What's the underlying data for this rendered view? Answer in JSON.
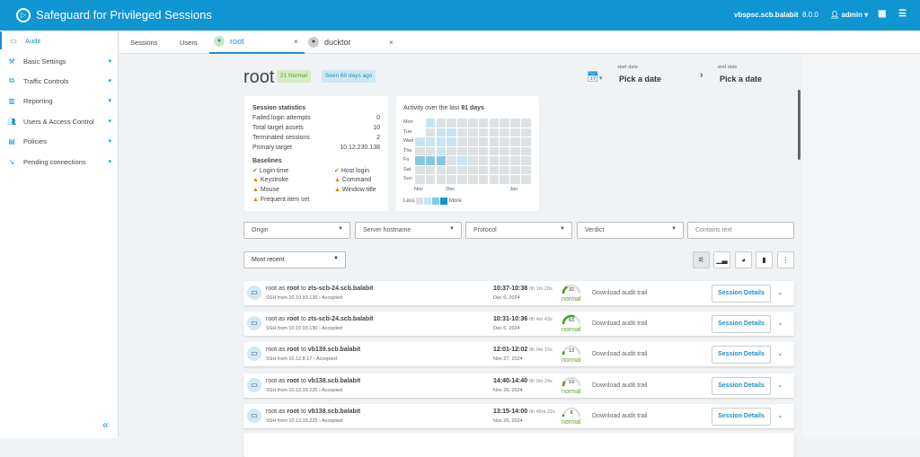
{
  "header": {
    "title": "Safeguard for Privileged Sessions",
    "host": "vbspsc.scb.balabit",
    "version": "8.0.0",
    "user": "admin"
  },
  "sidebar": {
    "items": [
      {
        "label": "Audit",
        "icon": "monitor-icon"
      },
      {
        "label": "Basic Settings",
        "icon": "wrench-icon"
      },
      {
        "label": "Traffic Controls",
        "icon": "network-icon"
      },
      {
        "label": "Reporting",
        "icon": "chart-icon"
      },
      {
        "label": "Users & Access Control",
        "icon": "users-icon"
      },
      {
        "label": "Policies",
        "icon": "policy-icon"
      },
      {
        "label": "Pending connections",
        "icon": "plug-icon"
      }
    ]
  },
  "tabs": [
    {
      "label": "Sessions"
    },
    {
      "label": "Users"
    },
    {
      "label": "root"
    },
    {
      "label": "ducktor"
    }
  ],
  "user": {
    "name": "root",
    "normal_badge": "21 Normal",
    "seen_badge": "Seen 60 days ago"
  },
  "dates": {
    "start_label": "start date",
    "start_value": "Pick a date",
    "end_label": "end date",
    "end_value": "Pick a date"
  },
  "stats": {
    "title": "Session statistics",
    "rows": [
      {
        "k": "Failed login attempts",
        "v": "0"
      },
      {
        "k": "Total target assets",
        "v": "10"
      },
      {
        "k": "Terminated sessions",
        "v": "2"
      },
      {
        "k": "Primary target",
        "v": "10.12.230.138"
      }
    ],
    "baselines_title": "Baselines",
    "baselines": [
      {
        "label": "Login time",
        "status": "ok"
      },
      {
        "label": "Host login",
        "status": "ok"
      },
      {
        "label": "Keystroke",
        "status": "warn"
      },
      {
        "label": "Command",
        "status": "warn"
      },
      {
        "label": "Mouse",
        "status": "warn"
      },
      {
        "label": "Window title",
        "status": "warn"
      },
      {
        "label": "Frequent item set",
        "status": "warn"
      }
    ]
  },
  "activity": {
    "title_prefix": "Activity over the last",
    "title_bold": "91 days",
    "days": [
      "Mon",
      "Tue",
      "Wed",
      "Thu",
      "Fri",
      "Sat",
      "Sun"
    ],
    "months": [
      "Nov",
      "Dec",
      "Jan"
    ],
    "less": "Less",
    "more": "More",
    "levels": [
      [
        null,
        1,
        0,
        0,
        0,
        0,
        0,
        0,
        0,
        0,
        0
      ],
      [
        null,
        0,
        1,
        1,
        0,
        0,
        0,
        0,
        0,
        0,
        0
      ],
      [
        1,
        1,
        1,
        1,
        0,
        0,
        0,
        0,
        0,
        0,
        0
      ],
      [
        0,
        0,
        1,
        0,
        0,
        0,
        0,
        0,
        0,
        0,
        0
      ],
      [
        2,
        2,
        2,
        0,
        1,
        0,
        0,
        0,
        0,
        0,
        0
      ],
      [
        0,
        0,
        0,
        0,
        0,
        0,
        0,
        0,
        0,
        0,
        0
      ],
      [
        0,
        0,
        0,
        0,
        0,
        0,
        0,
        0,
        0,
        0,
        0
      ]
    ],
    "colors": [
      "#dde1e4",
      "#c6e5f1",
      "#85c7e2",
      "#0f95d2"
    ]
  },
  "filters": {
    "origin": "Origin",
    "server": "Server hostname",
    "protocol": "Protocol",
    "verdict": "Verdict",
    "text_placeholder": "Contains text",
    "sort": "Most recent"
  },
  "sessions": [
    {
      "user": "root",
      "as": "root",
      "target": "zts-scb-24.scb.balabit",
      "sub": "SSH from 10.10.93.130 › Accepted",
      "time": "10:37-10:38",
      "dur": "0h 1m 20s",
      "date": "Dec 6, 2024",
      "score": 32,
      "verdict": "normal",
      "download": "Download audit trail",
      "details": "Session Details"
    },
    {
      "user": "root",
      "as": "root",
      "target": "zts-scb-24.scb.balabit",
      "sub": "SSH from 10.10.93.130 › Accepted",
      "time": "10:31-10:36",
      "dur": "0h 4m 43s",
      "date": "Dec 6, 2024",
      "score": 63,
      "verdict": "normal",
      "download": "Download audit trail",
      "details": "Session Details"
    },
    {
      "user": "root",
      "as": "root",
      "target": "vb139.scb.balabit",
      "sub": "SSH from 10.12.8.17 › Accepted",
      "time": "12:01-12:02",
      "dur": "0h 0m 15s",
      "date": "Nov 27, 2024",
      "score": 13,
      "verdict": "normal",
      "download": "Download audit trail",
      "details": "Session Details"
    },
    {
      "user": "root",
      "as": "root",
      "target": "vb138.scb.balabit",
      "sub": "SSH from 10.12.15.225 › Accepted",
      "time": "14:40-14:40",
      "dur": "0h 0m 24s",
      "date": "Nov 26, 2024",
      "score": 19,
      "verdict": "normal",
      "download": "Download audit trail",
      "details": "Session Details"
    },
    {
      "user": "root",
      "as": "root",
      "target": "vb138.scb.balabit",
      "sub": "SSH from 10.12.15.225 › Accepted",
      "time": "13:15-14:00",
      "dur": "0h 45m 22s",
      "date": "Nov 26, 2024",
      "score": 8,
      "verdict": "normal",
      "download": "Download audit trail",
      "details": "Session Details"
    }
  ],
  "words": {
    "as": "as",
    "to": "to"
  }
}
